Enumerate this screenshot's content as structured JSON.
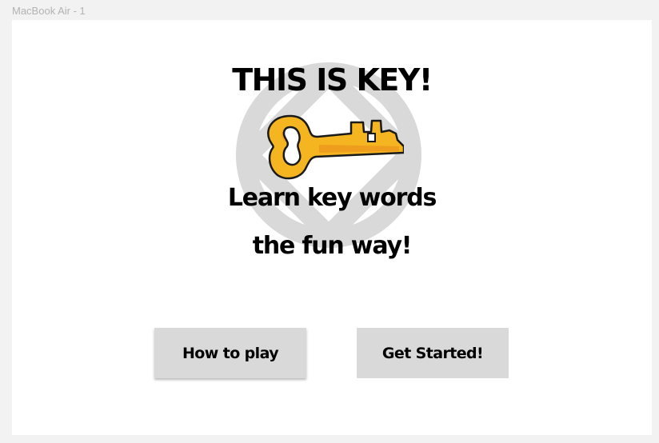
{
  "frame": {
    "label": "MacBook Air - 1"
  },
  "hero": {
    "title": "THIS IS KEY!",
    "tagline_line1": "Learn key words",
    "tagline_line2": "the fun way!"
  },
  "icons": {
    "background_emblem": "circle-diamond-emblem-icon",
    "key": "golden-key-icon"
  },
  "buttons": {
    "how_to_play": "How to play",
    "get_started": "Get Started!"
  },
  "colors": {
    "canvas_bg": "#f2f2f2",
    "artboard_bg": "#ffffff",
    "emblem": "#d9d9d9",
    "button_bg": "#d9d9d9",
    "key_gold": "#f5b521",
    "key_outline": "#1a1a1a",
    "text": "#000000"
  }
}
